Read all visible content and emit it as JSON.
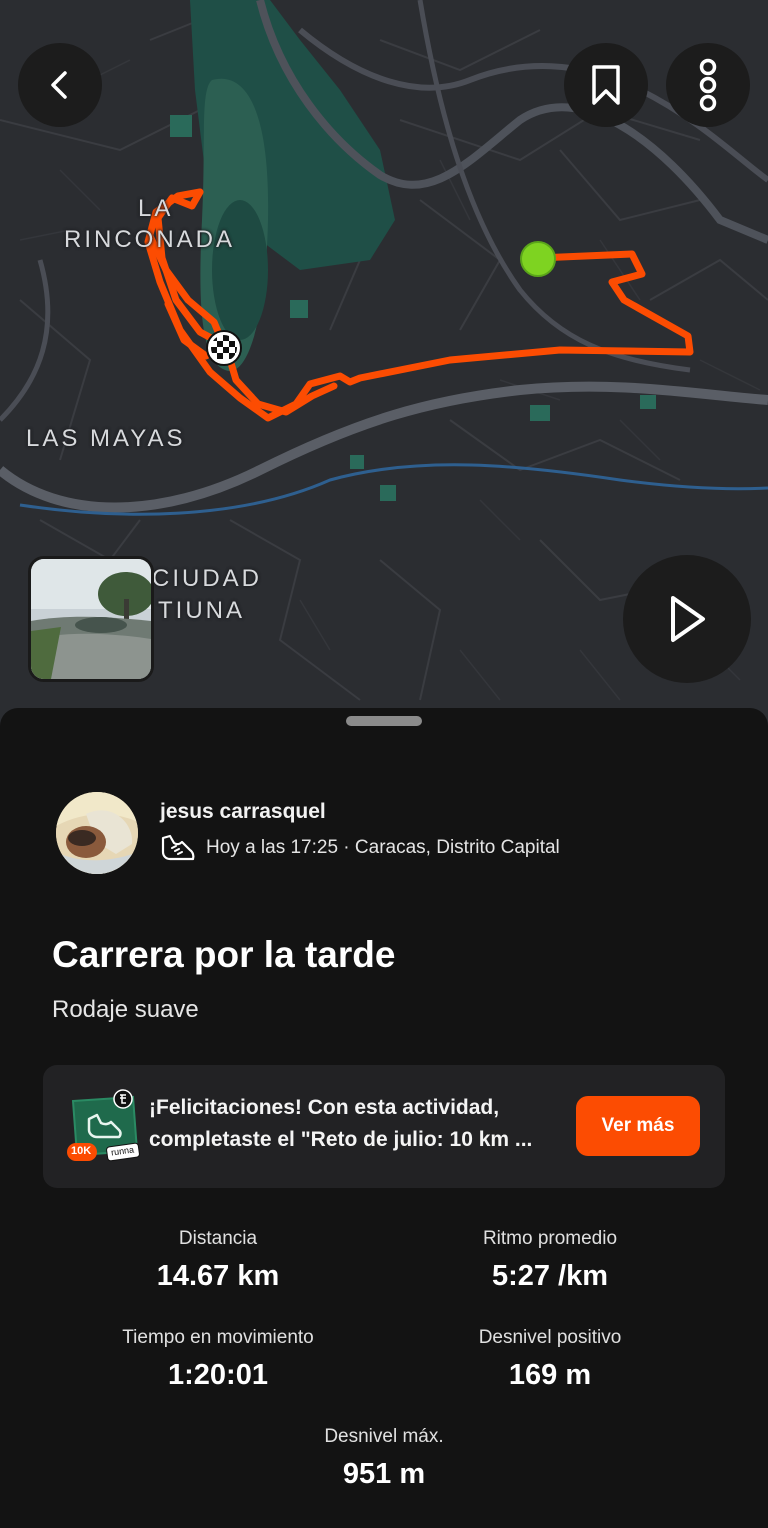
{
  "map": {
    "labels": [
      "LA",
      "RINCONADA",
      "LAS MAYAS",
      "CIUDAD",
      "TIUNA"
    ],
    "route_color": "#fc4c02",
    "start_marker_color": "#7ed321",
    "finish_marker_icon": "checkered-flag-icon"
  },
  "header": {
    "back_icon": "chevron-left-icon",
    "bookmark_icon": "bookmark-icon",
    "more_icon": "more-vertical-icon"
  },
  "media": {
    "play_icon": "play-icon",
    "photo_thumb": "photo-thumbnail"
  },
  "athlete": {
    "name": "jesus carrasquel",
    "meta": "Hoy a las 17:25 · Caracas, Distrito Capital",
    "activity_icon": "running-shoe-icon"
  },
  "activity": {
    "title": "Carrera por la tarde",
    "description": "Rodaje suave"
  },
  "banner": {
    "line1": "¡Felicitaciones! Con esta actividad,",
    "line2": "completaste el \"Reto de julio: 10 km ...",
    "button_label": "Ver más",
    "badge_label": "10K",
    "badge_brand": "runna"
  },
  "stats": {
    "distance": {
      "label": "Distancia",
      "value": "14.67 km"
    },
    "pace": {
      "label": "Ritmo promedio",
      "value": "5:27 /km"
    },
    "moving_time": {
      "label": "Tiempo en movimiento",
      "value": "1:20:01"
    },
    "elevation_gain": {
      "label": "Desnivel positivo",
      "value": "169 m"
    },
    "max_elevation": {
      "label": "Desnivel máx.",
      "value": "951 m"
    }
  },
  "colors": {
    "accent": "#fc4c02",
    "background": "#131313",
    "card": "#222224"
  }
}
